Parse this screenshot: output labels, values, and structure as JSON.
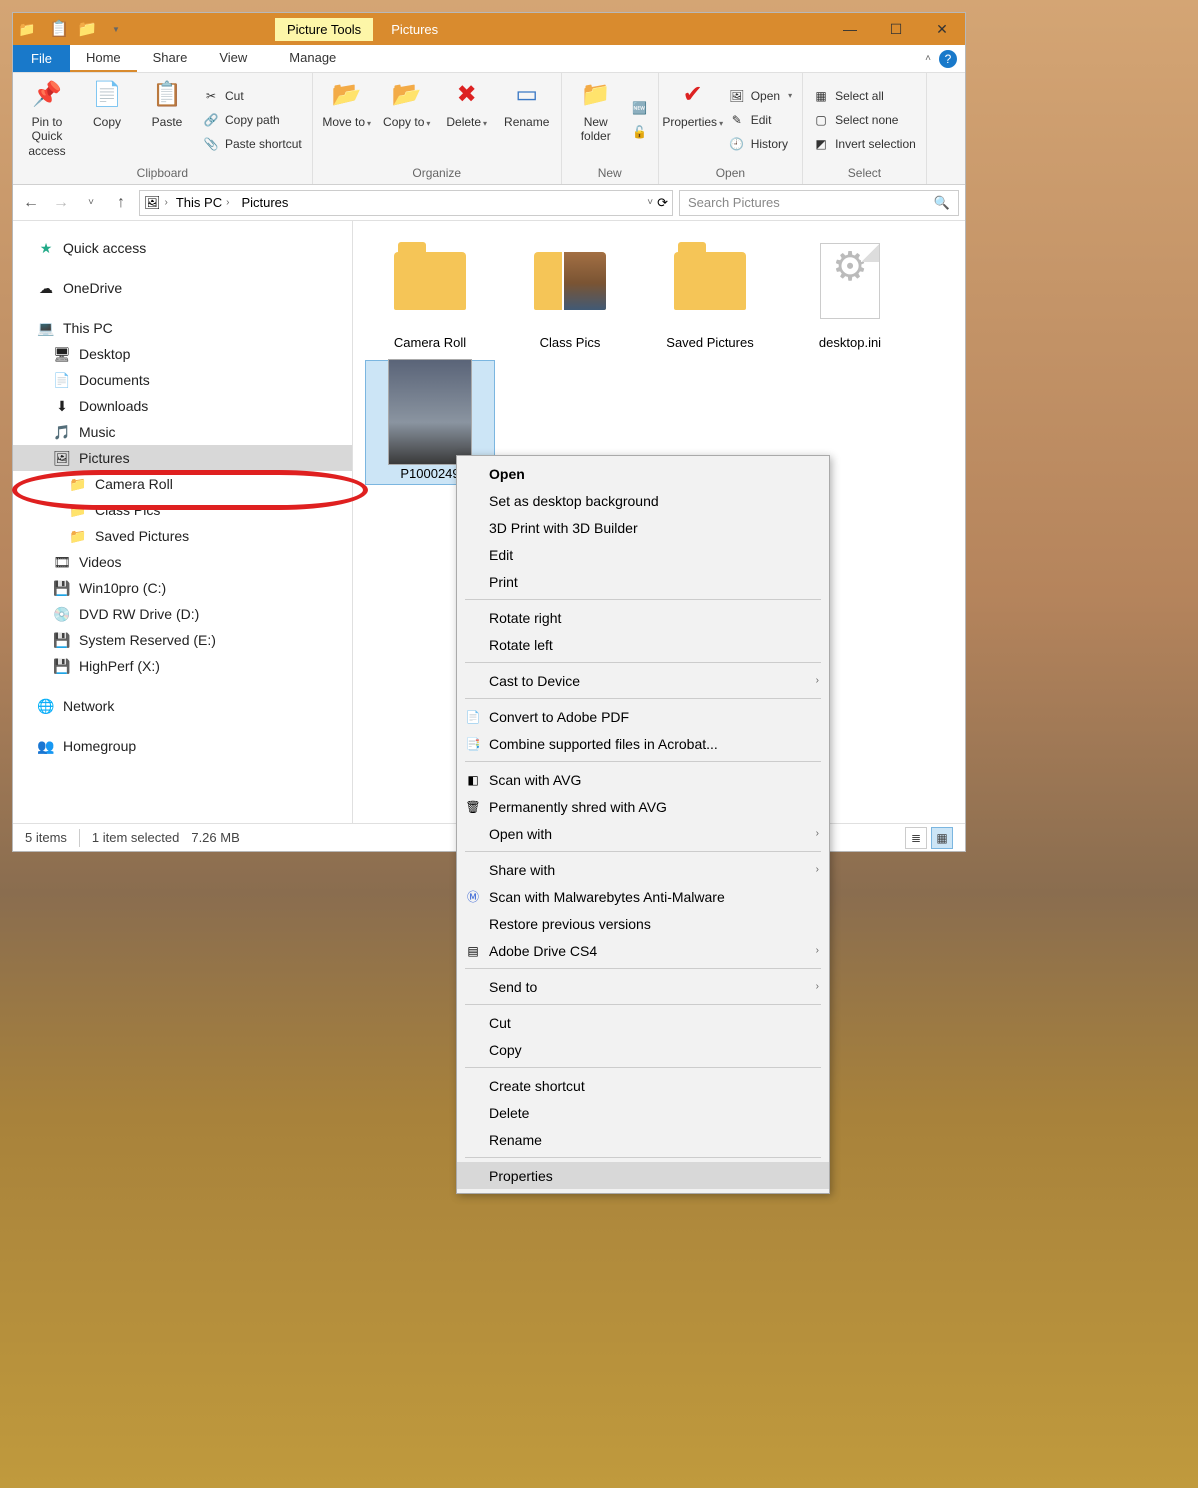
{
  "titlebar": {
    "tool_tab": "Picture Tools",
    "title": "Pictures"
  },
  "tabs": {
    "file": "File",
    "home": "Home",
    "share": "Share",
    "view": "View",
    "manage": "Manage"
  },
  "ribbon": {
    "clipboard": {
      "label": "Clipboard",
      "pin": "Pin to Quick access",
      "copy": "Copy",
      "paste": "Paste",
      "cut": "Cut",
      "copypath": "Copy path",
      "pasteshortcut": "Paste shortcut"
    },
    "organize": {
      "label": "Organize",
      "moveto": "Move to",
      "copyto": "Copy to",
      "delete": "Delete",
      "rename": "Rename"
    },
    "new": {
      "label": "New",
      "newfolder": "New folder"
    },
    "open": {
      "label": "Open",
      "properties": "Properties",
      "open": "Open",
      "edit": "Edit",
      "history": "History"
    },
    "select": {
      "label": "Select",
      "all": "Select all",
      "none": "Select none",
      "invert": "Invert selection"
    }
  },
  "breadcrumb": {
    "pc": "This PC",
    "pictures": "Pictures"
  },
  "search": {
    "placeholder": "Search Pictures"
  },
  "sidebar": {
    "quick": "Quick access",
    "onedrive": "OneDrive",
    "thispc": "This PC",
    "desktop": "Desktop",
    "documents": "Documents",
    "downloads": "Downloads",
    "music": "Music",
    "pictures": "Pictures",
    "cameraroll": "Camera Roll",
    "classpics": "Class Pics",
    "savedpics": "Saved Pictures",
    "videos": "Videos",
    "win10": "Win10pro (C:)",
    "dvd": "DVD RW Drive (D:)",
    "sysres": "System Reserved (E:)",
    "highperf": "HighPerf (X:)",
    "network": "Network",
    "homegroup": "Homegroup"
  },
  "items": {
    "cameraroll": "Camera Roll",
    "classpics": "Class Pics",
    "savedpics": "Saved Pictures",
    "desktopini": "desktop.ini",
    "photo": "P1000249"
  },
  "status": {
    "count": "5 items",
    "selected": "1 item selected",
    "size": "7.26 MB"
  },
  "ctx": {
    "open": "Open",
    "setbg": "Set as desktop background",
    "print3d": "3D Print with 3D Builder",
    "edit": "Edit",
    "print": "Print",
    "rotr": "Rotate right",
    "rotl": "Rotate left",
    "cast": "Cast to Device",
    "convpdf": "Convert to Adobe PDF",
    "combine": "Combine supported files in Acrobat...",
    "scanavg": "Scan with AVG",
    "shredavg": "Permanently shred with AVG",
    "openwith": "Open with",
    "sharewith": "Share with",
    "malware": "Scan with Malwarebytes Anti-Malware",
    "restore": "Restore previous versions",
    "adobecs4": "Adobe Drive CS4",
    "sendto": "Send to",
    "cut": "Cut",
    "copy": "Copy",
    "createsc": "Create shortcut",
    "delete": "Delete",
    "rename": "Rename",
    "properties": "Properties"
  }
}
